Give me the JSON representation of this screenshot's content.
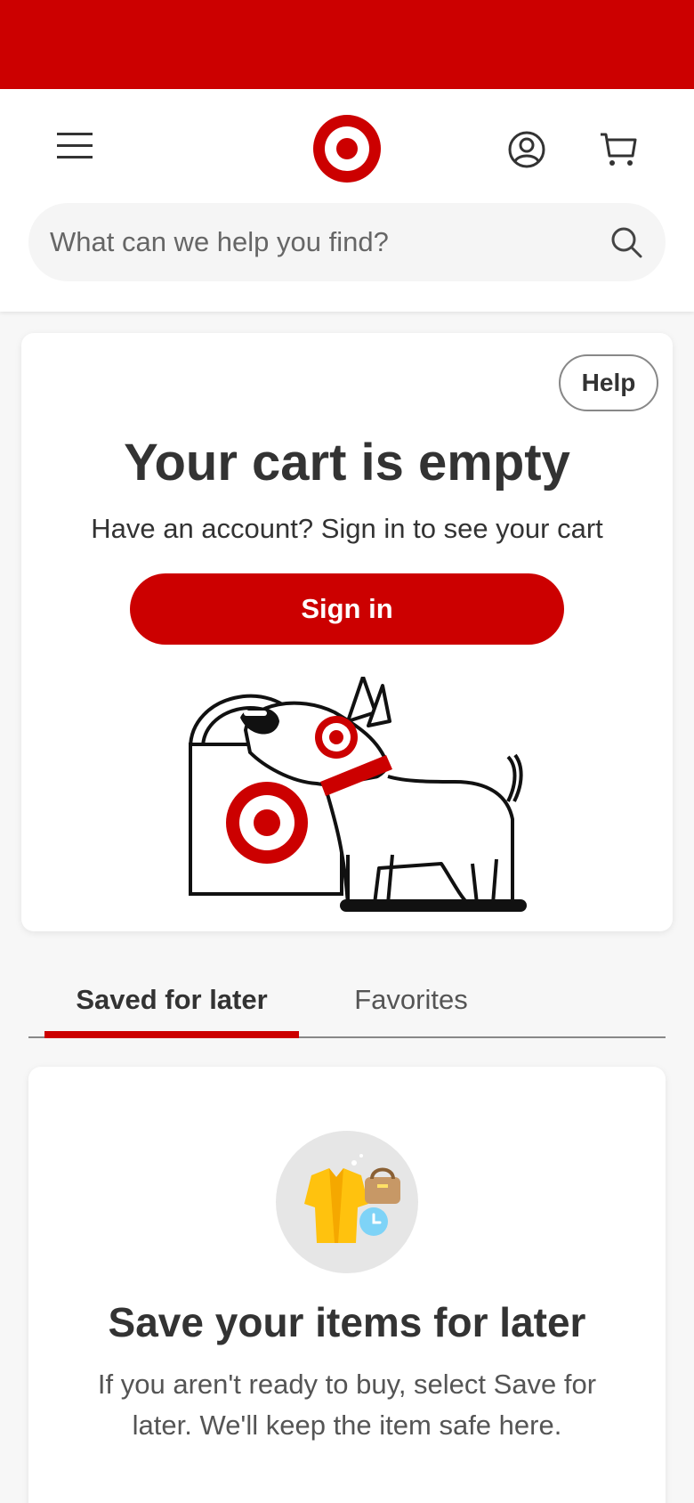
{
  "header": {
    "search_placeholder": "What can we help you find?",
    "icons": {
      "menu": "hamburger-menu-icon",
      "logo": "target-bullseye-logo",
      "account": "account-icon",
      "cart": "cart-icon",
      "search": "search-icon"
    }
  },
  "cart": {
    "help_label": "Help",
    "title": "Your cart is empty",
    "subtitle": "Have an account? Sign in to see your cart",
    "signin_label": "Sign in"
  },
  "tabs": [
    {
      "label": "Saved for later",
      "active": true
    },
    {
      "label": "Favorites",
      "active": false
    }
  ],
  "saved": {
    "title": "Save your items for later",
    "description": "If you aren't ready to buy, select Save for later. We'll keep the item safe here."
  },
  "colors": {
    "brand_red": "#cc0000",
    "text_dark": "#333333"
  }
}
